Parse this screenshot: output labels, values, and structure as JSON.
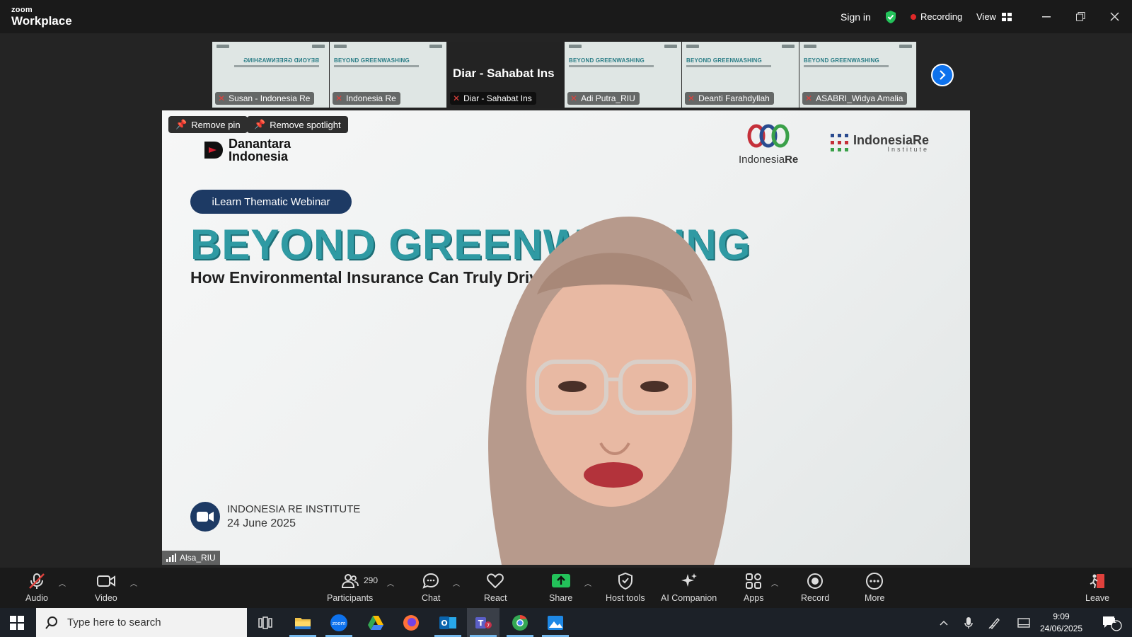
{
  "titlebar": {
    "brand_top": "zoom",
    "brand_bottom": "Workplace",
    "sign_in": "Sign in",
    "recording": "Recording",
    "view": "View"
  },
  "gallery": [
    {
      "name": "Susan - Indonesia Re",
      "type": "slide-mirror"
    },
    {
      "name": "Indonesia Re",
      "type": "slide"
    },
    {
      "name": "Diar - Sahabat Ins",
      "type": "name",
      "big_name": "Diar - Sahabat Ins"
    },
    {
      "name": "Adi Putra_RIU",
      "type": "slide"
    },
    {
      "name": "Deanti Farahdyllah",
      "type": "slide"
    },
    {
      "name": "ASABRI_Widya Amalia",
      "type": "slide"
    }
  ],
  "gallery_mini_title": "BEYOND GREENWASHING",
  "stage": {
    "remove_pin": "Remove pin",
    "remove_spotlight": "Remove spotlight",
    "danantara_line1": "Danantara",
    "danantara_line2": "Indonesia",
    "ire_name_a": "Indonesia",
    "ire_name_b": "Re",
    "ire_institute": "IndonesiaRe",
    "ire_institute_sub": "Institute",
    "webinar_pill": "iLearn Thematic Webinar",
    "title": "BEYOND GREENWASHING",
    "subtitle": "How Environmental Insurance Can Truly Drive Sustainability",
    "org_name": "INDONESIA RE INSTITUTE",
    "org_date": "24 June 2025",
    "speaker": "Alsa_RIU"
  },
  "toolbar": {
    "audio": "Audio",
    "video": "Video",
    "participants": "Participants",
    "participants_count": "290",
    "chat": "Chat",
    "react": "React",
    "share": "Share",
    "host_tools": "Host tools",
    "ai_companion": "AI Companion",
    "apps": "Apps",
    "record": "Record",
    "more": "More",
    "leave": "Leave"
  },
  "taskbar": {
    "search_placeholder": "Type here to search",
    "time": "9:09",
    "date": "24/06/2025",
    "notifications": "21"
  },
  "colors": {
    "accent_blue": "#0e72ed",
    "recording_red": "#e02828",
    "share_green": "#23c25a",
    "title_teal": "#2f9aa3",
    "pill_navy": "#1d3a64"
  }
}
